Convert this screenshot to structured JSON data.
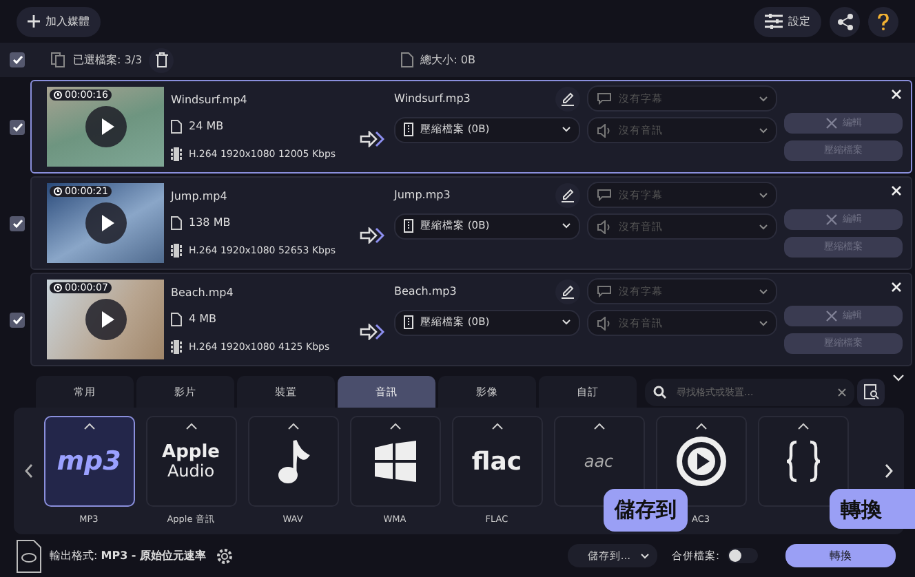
{
  "toolbar": {
    "add_media": "加入媒體",
    "settings": "設定"
  },
  "selection_bar": {
    "checked": true,
    "selected_files": "已選檔案: 3/3",
    "total_size": "總大小: 0B"
  },
  "files": [
    {
      "checked": true,
      "selected": true,
      "duration": "00:00:16",
      "name": "Windsurf.mp4",
      "size": "24 MB",
      "codec": "H.264 1920x1080 12005 Kbps",
      "output_name": "Windsurf.mp3",
      "output_select": "壓縮檔案 (0B)",
      "subtitle": "沒有字幕",
      "audio": "沒有音訊",
      "edit": "編輯",
      "compress": "壓縮檔案"
    },
    {
      "checked": true,
      "selected": false,
      "duration": "00:00:21",
      "name": "Jump.mp4",
      "size": "138 MB",
      "codec": "H.264 1920x1080 52653 Kbps",
      "output_name": "Jump.mp3",
      "output_select": "壓縮檔案 (0B)",
      "subtitle": "沒有字幕",
      "audio": "沒有音訊",
      "edit": "編輯",
      "compress": "壓縮檔案"
    },
    {
      "checked": true,
      "selected": false,
      "duration": "00:00:07",
      "name": "Beach.mp4",
      "size": "4 MB",
      "codec": "H.264 1920x1080 4125 Kbps",
      "output_name": "Beach.mp3",
      "output_select": "壓縮檔案 (0B)",
      "subtitle": "沒有字幕",
      "audio": "沒有音訊",
      "edit": "編輯",
      "compress": "壓縮檔案"
    }
  ],
  "format_tabs": [
    {
      "label": "常用",
      "selected": false
    },
    {
      "label": "影片",
      "selected": false
    },
    {
      "label": "裝置",
      "selected": false
    },
    {
      "label": "音訊",
      "selected": true
    },
    {
      "label": "影像",
      "selected": false
    },
    {
      "label": "自訂",
      "selected": false
    }
  ],
  "format_search": {
    "placeholder": "尋找格式或裝置..."
  },
  "formats": [
    {
      "kind": "mp3",
      "logo": "mp3",
      "label": "MP3",
      "selected": true
    },
    {
      "kind": "apple",
      "logo": "Apple",
      "logo_sub": "Audio",
      "label": "Apple 音訊",
      "selected": false
    },
    {
      "kind": "note",
      "label": "WAV",
      "selected": false
    },
    {
      "kind": "windows",
      "label": "WMA",
      "selected": false
    },
    {
      "kind": "flac",
      "logo": "flac",
      "label": "FLAC",
      "selected": false
    },
    {
      "kind": "aac",
      "logo": "aac",
      "selected": false
    },
    {
      "kind": "play",
      "label": "AC3",
      "selected": false
    },
    {
      "kind": "braces",
      "selected": false
    }
  ],
  "bottom_bar": {
    "output_format": "輸出格式: **MP3 - 原始位元速率**",
    "save_to": "儲存到...",
    "merge_label": "合併檔案:",
    "merge_on": false,
    "convert": "轉換"
  },
  "callouts": [
    {
      "kind": "save",
      "text": "儲存到"
    },
    {
      "kind": "convert",
      "text": "轉換"
    }
  ]
}
